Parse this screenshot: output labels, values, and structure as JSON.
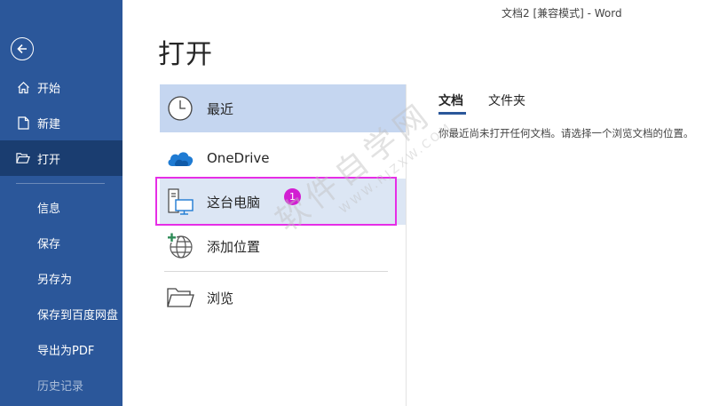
{
  "window": {
    "title": "文档2 [兼容模式]  -  Word"
  },
  "sidebar": {
    "items": [
      {
        "label": "开始",
        "icon": "home-icon"
      },
      {
        "label": "新建",
        "icon": "new-document-icon"
      },
      {
        "label": "打开",
        "icon": "folder-open-icon",
        "active": true
      },
      {
        "label": "信息"
      },
      {
        "label": "保存"
      },
      {
        "label": "另存为"
      },
      {
        "label": "保存到百度网盘"
      },
      {
        "label": "导出为PDF"
      },
      {
        "label": "历史记录",
        "disabled": true
      }
    ]
  },
  "page": {
    "title": "打开"
  },
  "locations": [
    {
      "label": "最近",
      "icon": "clock-icon",
      "state": "selected"
    },
    {
      "label": "OneDrive",
      "icon": "cloud-icon"
    },
    {
      "label": "这台电脑",
      "icon": "computer-icon",
      "state": "hover"
    },
    {
      "label": "添加位置",
      "icon": "globe-add-icon"
    },
    {
      "label": "浏览",
      "icon": "folder-icon"
    }
  ],
  "annotation": {
    "badge": "1"
  },
  "content": {
    "tabs": [
      {
        "label": "文档",
        "active": true
      },
      {
        "label": "文件夹"
      }
    ],
    "empty_message": "你最近尚未打开任何文档。请选择一个浏览文档的位置。"
  },
  "watermark": {
    "text": "软件自学网",
    "sub": "WWW.RJZXW.COM"
  },
  "colors": {
    "sidebar": "#2b579a",
    "sidebar_active": "#1a3d70",
    "selected": "#c5d6f0",
    "annotation": "#e62ee6"
  }
}
